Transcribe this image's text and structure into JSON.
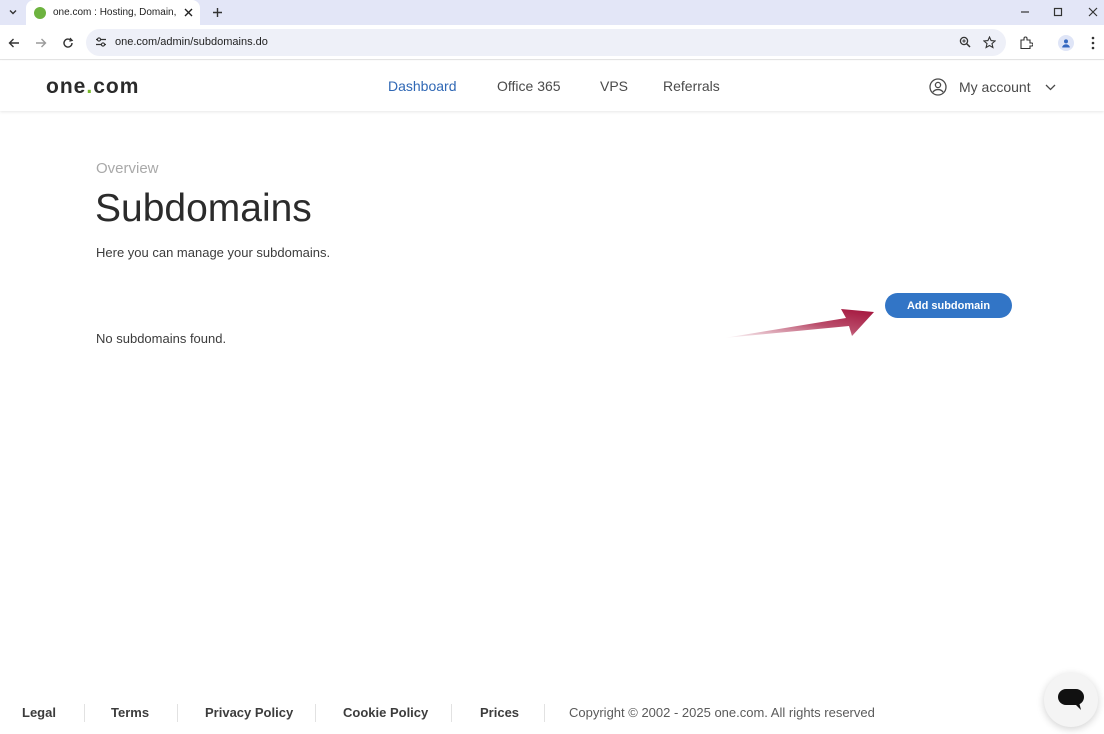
{
  "browser": {
    "tab_title": "one.com : Hosting, Domain, Em",
    "url": "one.com/admin/subdomains.do"
  },
  "site": {
    "logo_text": "one",
    "logo_dot": ".",
    "logo_tld": "com",
    "nav": [
      {
        "label": "Dashboard",
        "active": true
      },
      {
        "label": "Office 365",
        "active": false
      },
      {
        "label": "VPS",
        "active": false
      },
      {
        "label": "Referrals",
        "active": false
      }
    ],
    "account_label": "My account"
  },
  "content": {
    "breadcrumb": "Overview",
    "title": "Subdomains",
    "intro": "Here you can manage your subdomains.",
    "add_button": "Add subdomain",
    "empty_message": "No subdomains found."
  },
  "footer": {
    "links": [
      "Legal",
      "Terms",
      "Privacy Policy",
      "Cookie Policy",
      "Prices"
    ],
    "copyright": "Copyright © 2002 - 2025 one.com. All rights reserved"
  },
  "colors": {
    "accent": "#3275c6",
    "active_nav": "#3068b5",
    "logo_dot": "#76b82a",
    "annotation_arrow": "#a3123a"
  }
}
